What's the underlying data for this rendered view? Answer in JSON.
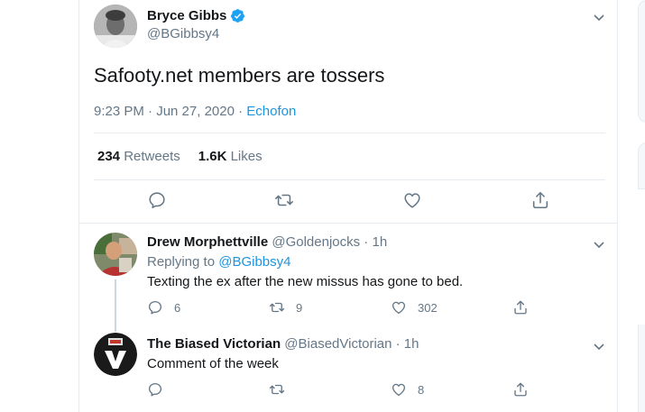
{
  "main_tweet": {
    "author_name": "Bryce Gibbs",
    "author_handle": "@BGibbsy4",
    "text": "Safooty.net members are tossers",
    "timestamp": "9:23 PM · Jun 27, 2020 · ",
    "source": "Echofon",
    "retweets_count": "234",
    "retweets_label": "Retweets",
    "likes_count": "1.6K",
    "likes_label": "Likes"
  },
  "replies": [
    {
      "name": "Drew Morphettville",
      "handle": "@Goldenjocks",
      "time": " · 1h",
      "replying_prefix": "Replying to ",
      "replying_to": "@BGibbsy4",
      "text": "Texting the ex after the new missus has gone to bed.",
      "reply_count": "6",
      "retweet_count": "9",
      "like_count": "302"
    },
    {
      "name": "The Biased Victorian",
      "handle": "@BiasedVictorian",
      "time": " · 1h",
      "text": "Comment of the week",
      "reply_count": "",
      "retweet_count": "",
      "like_count": "8"
    }
  ],
  "colors": {
    "accent": "#1b95e0",
    "verified": "#1da1f2",
    "muted": "#657786",
    "text": "#14171a",
    "border": "#e6ecf0"
  },
  "icons": [
    "verified-badge-icon",
    "chevron-down-icon",
    "reply-icon",
    "retweet-icon",
    "like-icon",
    "share-icon"
  ]
}
